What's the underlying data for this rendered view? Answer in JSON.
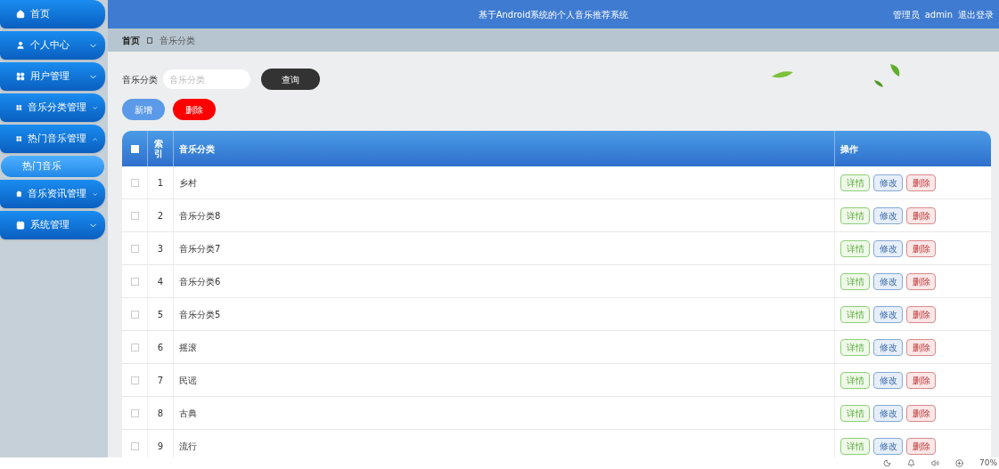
{
  "header": {
    "title": "基于Android系统的个人音乐推荐系统",
    "role": "管理员",
    "user": "admin",
    "logout": "退出登录"
  },
  "sidebar": {
    "items": [
      {
        "kind": "link",
        "label": "首页"
      },
      {
        "kind": "menu",
        "label": "个人中心",
        "expanded": false
      },
      {
        "kind": "menu",
        "label": "用户管理",
        "expanded": false
      },
      {
        "kind": "menu",
        "label": "音乐分类管理",
        "expanded": false
      },
      {
        "kind": "menu",
        "label": "热门音乐管理",
        "expanded": true,
        "children": [
          {
            "label": "热门音乐",
            "selected": true
          }
        ]
      },
      {
        "kind": "menu",
        "label": "音乐资讯管理",
        "expanded": false
      },
      {
        "kind": "menu",
        "label": "系统管理",
        "expanded": false
      }
    ]
  },
  "breadcrumb": [
    "首页",
    "音乐分类"
  ],
  "search": {
    "label": "音乐分类",
    "placeholder": "音乐分类",
    "button": "查询"
  },
  "actions": [
    {
      "kind": "add",
      "label": "新增"
    },
    {
      "kind": "delete",
      "label": "删除"
    }
  ],
  "table": {
    "all_checked": false,
    "columns": [
      "索引",
      "音乐分类",
      "操作"
    ],
    "rows": [
      {
        "index": "1",
        "name": "乡村",
        "checked": false,
        "actions": [
          {
            "kind": "detail",
            "label": "详情"
          },
          {
            "kind": "edit",
            "label": "修改"
          },
          {
            "kind": "delete",
            "label": "删除"
          }
        ]
      },
      {
        "index": "2",
        "name": "音乐分类8",
        "checked": false,
        "actions": [
          {
            "kind": "detail",
            "label": "详情"
          },
          {
            "kind": "edit",
            "label": "修改"
          },
          {
            "kind": "delete",
            "label": "删除"
          }
        ]
      },
      {
        "index": "3",
        "name": "音乐分类7",
        "checked": false,
        "actions": [
          {
            "kind": "detail",
            "label": "详情"
          },
          {
            "kind": "edit",
            "label": "修改"
          },
          {
            "kind": "delete",
            "label": "删除"
          }
        ]
      },
      {
        "index": "4",
        "name": "音乐分类6",
        "checked": false,
        "actions": [
          {
            "kind": "detail",
            "label": "详情"
          },
          {
            "kind": "edit",
            "label": "修改"
          },
          {
            "kind": "delete",
            "label": "删除"
          }
        ]
      },
      {
        "index": "5",
        "name": "音乐分类5",
        "checked": false,
        "actions": [
          {
            "kind": "detail",
            "label": "详情"
          },
          {
            "kind": "edit",
            "label": "修改"
          },
          {
            "kind": "delete",
            "label": "删除"
          }
        ]
      },
      {
        "index": "6",
        "name": "摇滚",
        "checked": false,
        "actions": [
          {
            "kind": "detail",
            "label": "详情"
          },
          {
            "kind": "edit",
            "label": "修改"
          },
          {
            "kind": "delete",
            "label": "删除"
          }
        ]
      },
      {
        "index": "7",
        "name": "民谣",
        "checked": false,
        "actions": [
          {
            "kind": "detail",
            "label": "详情"
          },
          {
            "kind": "edit",
            "label": "修改"
          },
          {
            "kind": "delete",
            "label": "删除"
          }
        ]
      },
      {
        "index": "8",
        "name": "古典",
        "checked": false,
        "actions": [
          {
            "kind": "detail",
            "label": "详情"
          },
          {
            "kind": "edit",
            "label": "修改"
          },
          {
            "kind": "delete",
            "label": "删除"
          }
        ]
      },
      {
        "index": "9",
        "name": "流行",
        "checked": false,
        "actions": [
          {
            "kind": "detail",
            "label": "详情"
          },
          {
            "kind": "edit",
            "label": "修改"
          },
          {
            "kind": "delete",
            "label": "删除"
          }
        ]
      }
    ]
  },
  "status_bar": {
    "zoom": "70%"
  }
}
